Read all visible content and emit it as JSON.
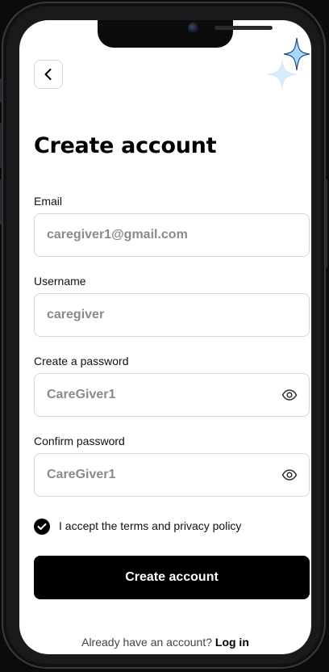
{
  "header": {
    "back_icon": "chevron-left-icon",
    "title": "Create account"
  },
  "form": {
    "email": {
      "label": "Email",
      "value": "caregiver1@gmail.com"
    },
    "username": {
      "label": "Username",
      "value": "caregiver"
    },
    "password": {
      "label": "Create a password",
      "value": "CareGiver1",
      "icon": "eye-icon"
    },
    "confirm": {
      "label": "Confirm password",
      "value": "CareGiver1",
      "icon": "eye-icon"
    },
    "terms": {
      "checked": true,
      "label": "I accept the terms and privacy policy"
    },
    "submit_label": "Create account"
  },
  "footer": {
    "prompt": "Already have an account?",
    "login_label": "Log in"
  },
  "colors": {
    "primary": "#000000",
    "field_border": "#d6d6d6",
    "placeholder_text": "#8a8a8a",
    "sparkle": "#a7d8f5"
  }
}
